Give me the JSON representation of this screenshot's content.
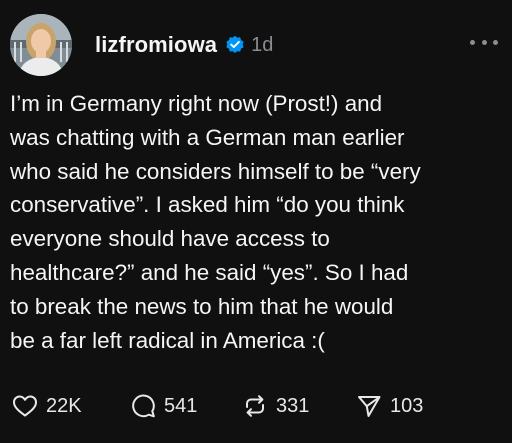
{
  "post": {
    "author": "lizfromiowa",
    "verified": true,
    "time": "1d",
    "text": "I’m in Germany right now (Prost!) and\nwas chatting with a German man earlier\nwho said he considers himself to be “very\nconservative”. I asked him “do you think\neveryone should have access to\nhealthcare?” and he said “yes”. So I had\nto break the news to him that he would\nbe a far left radical in America :(",
    "actions": {
      "likes": "22K",
      "replies": "541",
      "reposts": "331",
      "shares": "103"
    }
  },
  "icons": {
    "verified": "verified-badge-icon",
    "more": "more-options-icon",
    "like": "heart-icon",
    "reply": "comment-icon",
    "repost": "repost-icon",
    "share": "send-icon"
  },
  "colors": {
    "background": "#101010",
    "text": "#f3f5f7",
    "muted": "#8a8d91",
    "verified": "#0095f6"
  }
}
